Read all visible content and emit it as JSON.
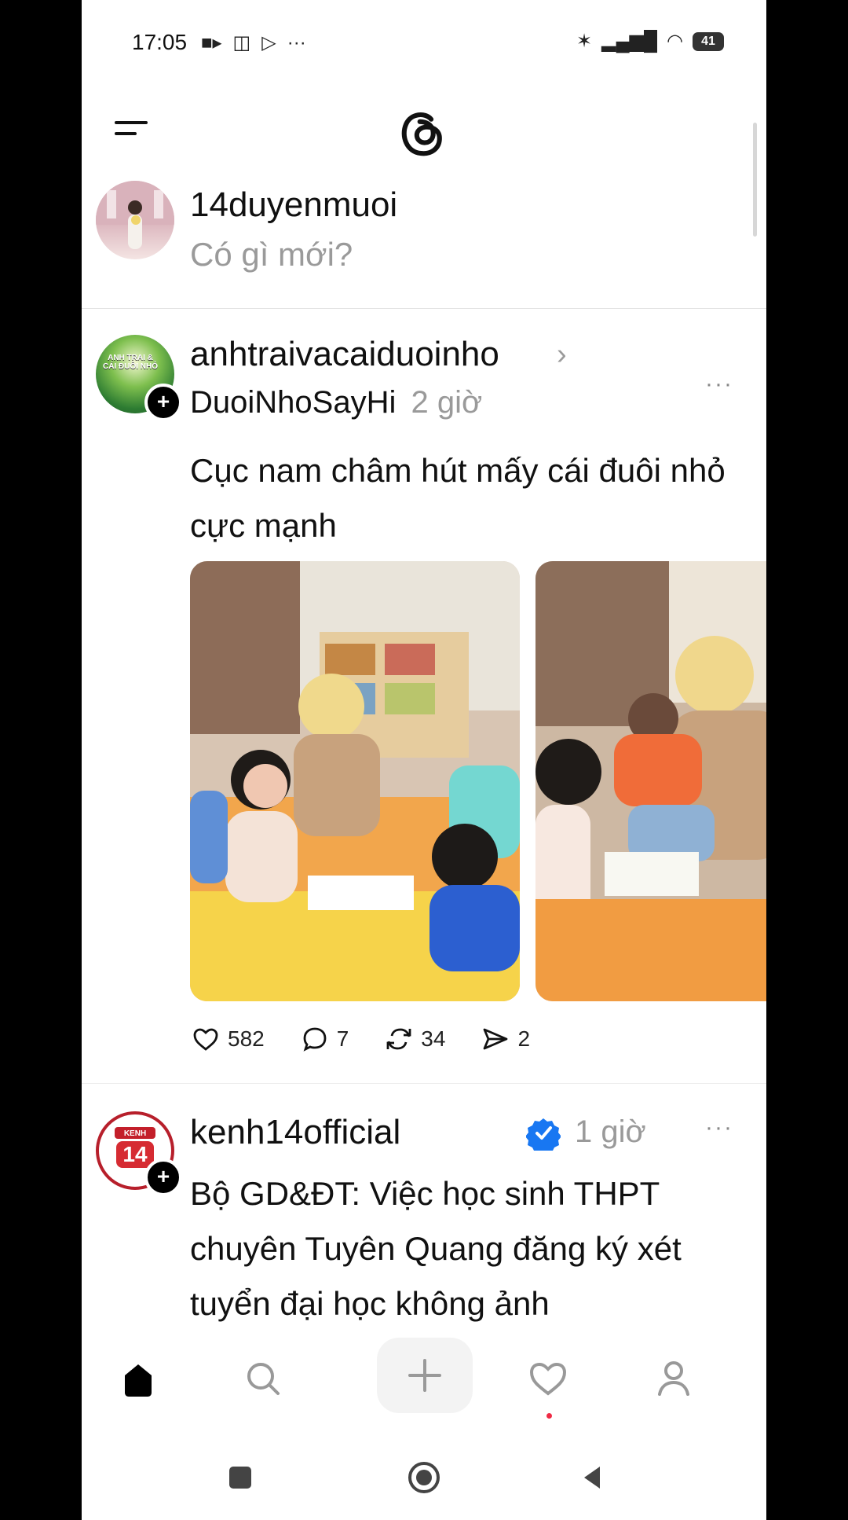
{
  "status_bar": {
    "time": "17:05",
    "battery": "41"
  },
  "composer": {
    "username": "14duyenmuoi",
    "placeholder": "Có gì mới?"
  },
  "posts": [
    {
      "username": "anhtraivacaiduoinho",
      "avatar_text": "ANH TRAI & CÁI ĐUÔI NHỎ",
      "community": "DuoiNhoSayHi",
      "time": "2 giờ",
      "caption": "Cục nam châm hút mấy cái đuôi nhỏ cực mạnh",
      "actions": {
        "likes": "582",
        "comments": "7",
        "reposts": "34",
        "shares": "2"
      }
    },
    {
      "username": "kenh14official",
      "avatar_text": "KENH 14",
      "time": "1 giờ",
      "caption": "Bộ GD&ĐT: Việc học sinh THPT chuyên Tuyên Quang đăng ký xét tuyển đại học không ảnh"
    }
  ],
  "colors": {
    "accent_blue": "#1877f2",
    "brand_red": "#b71f2b",
    "notification_red": "#ef2b45"
  }
}
